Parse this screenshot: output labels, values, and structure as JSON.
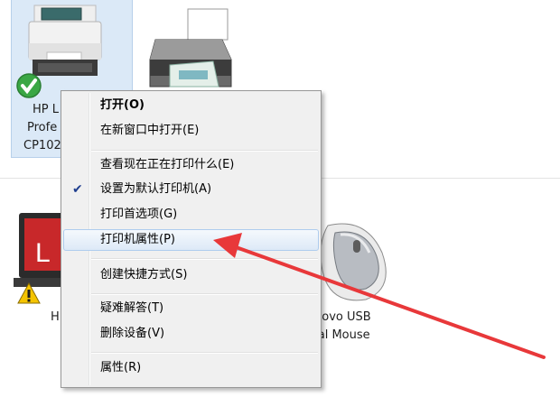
{
  "devices_top": [
    {
      "label_lines": [
        "HP L",
        "Profe",
        "CP102"
      ],
      "default": true,
      "selected": true
    },
    {
      "label_lines": [],
      "default": false,
      "selected": false
    }
  ],
  "devices_bottom": [
    {
      "label_lines": [
        "H"
      ],
      "warning": true
    },
    {
      "label_lines": [
        "novo USB",
        "ical Mouse"
      ],
      "warning": false
    }
  ],
  "context_menu": {
    "items": [
      {
        "label": "打开(O)",
        "bold": true
      },
      {
        "label": "在新窗口中打开(E)"
      },
      {
        "label": "查看现在正在打印什么(E)"
      },
      {
        "label": "设置为默认打印机(A)",
        "checked": true
      },
      {
        "label": "打印首选项(G)"
      },
      {
        "label": "打印机属性(P)",
        "highlighted": true
      },
      {
        "label": "创建快捷方式(S)"
      },
      {
        "label": "疑难解答(T)"
      },
      {
        "label": "删除设备(V)"
      },
      {
        "label": "属性(R)"
      }
    ]
  },
  "colors": {
    "arrow": "#e8383a",
    "selection": "#dbe9f7",
    "menu_bg": "#f0f0f0",
    "check": "#1f3f8f"
  },
  "icons": [
    "printer-icon",
    "default-check-icon",
    "warning-icon",
    "mouse-icon",
    "arrow-annotation"
  ]
}
